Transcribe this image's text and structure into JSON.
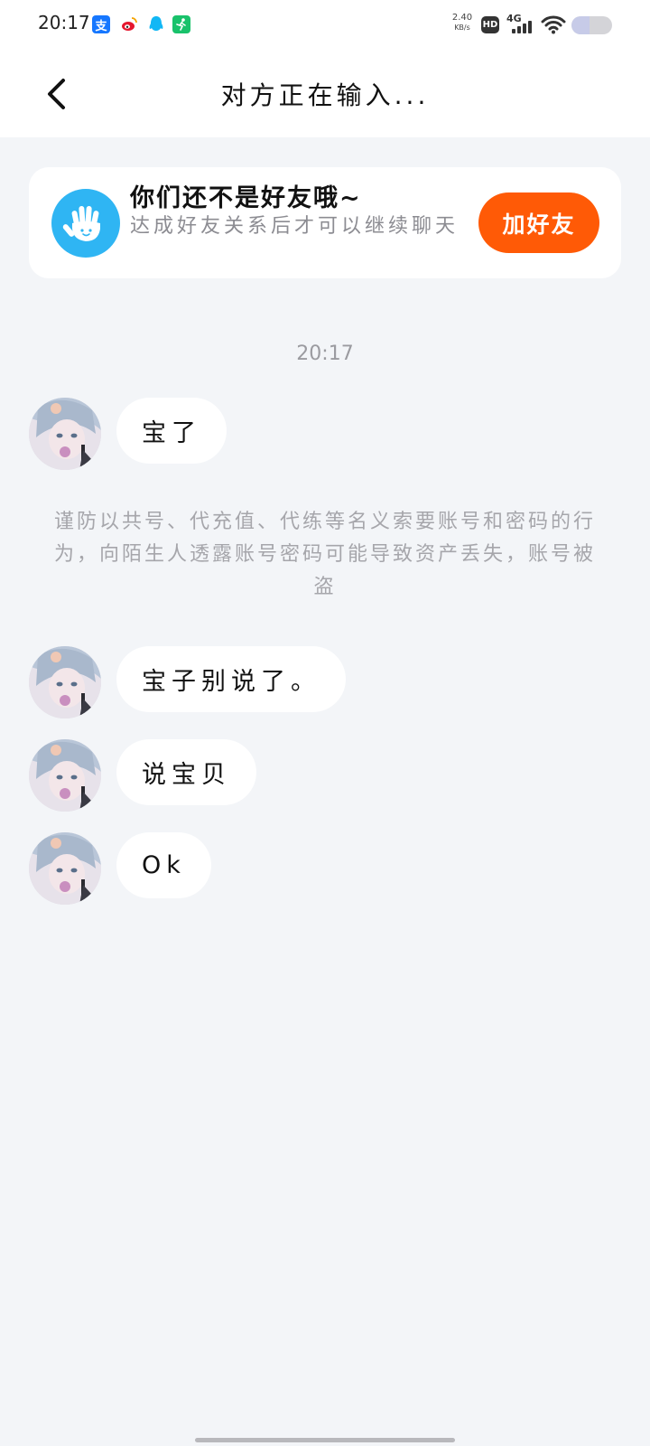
{
  "status_bar": {
    "time": "20:17",
    "net_speed_value": "2.40",
    "net_speed_unit": "KB/s",
    "hd_label": "HD",
    "network_type": "4G",
    "app_icons": [
      "alipay-icon",
      "weibo-icon",
      "qq-icon",
      "sport-icon"
    ],
    "battery_level": 0.45
  },
  "header": {
    "title": "对方正在输入..."
  },
  "friend_card": {
    "title": "你们还不是好友哦~",
    "subtitle": "达成好友关系后才可以继续聊天",
    "add_button_label": "加好友"
  },
  "chat": {
    "timestamp": "20:17",
    "warning": "谨防以共号、代充值、代练等名义索要账号和密码的行为，向陌生人透露账号密码可能导致资产丢失，账号被盗",
    "messages": [
      {
        "text": "宝了"
      },
      {
        "text": "宝子别说了。"
      },
      {
        "text": "说宝贝"
      },
      {
        "text": "Ok"
      }
    ]
  },
  "colors": {
    "background": "#f3f5f8",
    "accent_orange": "#ff5a06",
    "hand_blue": "#2fb5f3",
    "bubble": "#ffffff"
  }
}
